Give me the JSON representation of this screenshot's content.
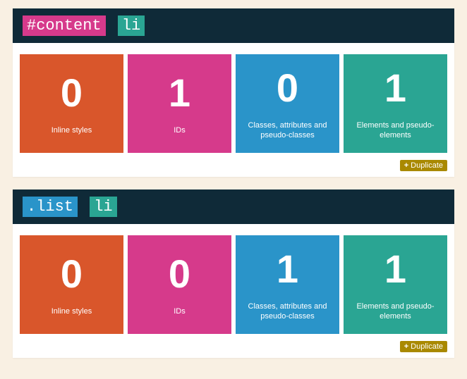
{
  "labels": {
    "inline": "Inline styles",
    "ids": "IDs",
    "classes": "Classes, attributes and pseudo-classes",
    "elements": "Elements and pseudo-elements",
    "duplicate": "Duplicate",
    "plus": "+"
  },
  "cards": [
    {
      "tokens": [
        {
          "text": "#content",
          "kind": "id"
        },
        {
          "text": "li",
          "kind": "el"
        }
      ],
      "values": {
        "inline": "0",
        "ids": "1",
        "classes": "0",
        "elements": "1"
      }
    },
    {
      "tokens": [
        {
          "text": ".list",
          "kind": "class"
        },
        {
          "text": "li",
          "kind": "el"
        }
      ],
      "values": {
        "inline": "0",
        "ids": "0",
        "classes": "1",
        "elements": "1"
      }
    }
  ]
}
